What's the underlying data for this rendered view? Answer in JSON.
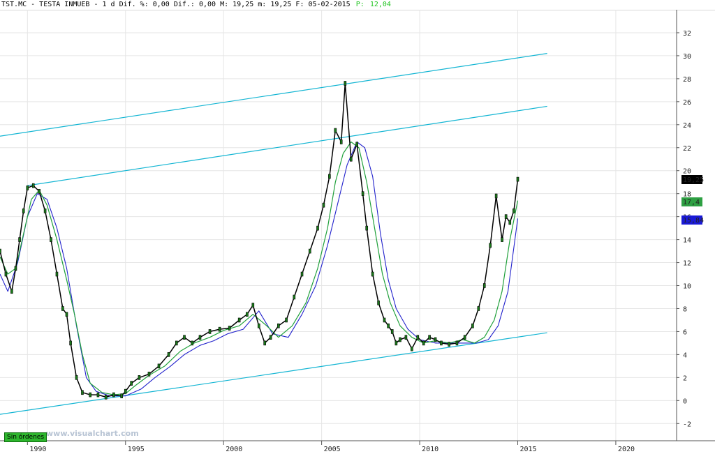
{
  "header": {
    "symbol_info": "TST.MC - TESTA INMUEB - 1 d Dif. %: 0,00 Dif.: 0,00 M: 19,25 m: 19,25 F: 05-02-2015",
    "p_label": "P:",
    "p_value": "12,04"
  },
  "badges": {
    "last_price": "19,25",
    "green_ma": "17,4",
    "blue_ma": "15,84"
  },
  "footer": {
    "status_button": "Sin órdenes",
    "watermark": "www.visualchart.com"
  },
  "colors": {
    "price": "#000000",
    "price_body": "#1a7a1a",
    "fast_ma": "#1fa03a",
    "slow_ma": "#2222cc",
    "channel": "#13b5d3",
    "grid": "#e6e6e6",
    "badge_last": "#000000",
    "badge_green": "#2ea043",
    "badge_blue": "#1a1ad6"
  },
  "chart_data": {
    "type": "line",
    "x_ticks": [
      "1990",
      "1995",
      "2000",
      "2005",
      "2010",
      "2015",
      "2020"
    ],
    "y_ticks": [
      "-2",
      "0",
      "2",
      "4",
      "6",
      "8",
      "10",
      "12",
      "14",
      "16",
      "18",
      "20",
      "22",
      "24",
      "26",
      "28",
      "30",
      "32"
    ],
    "ylim": [
      -3.5,
      34
    ],
    "xlim": [
      1988.6,
      2023.1
    ],
    "grid": true,
    "series": [
      {
        "key": "price",
        "x": [
          1988.6,
          1988.9,
          1989.2,
          1989.4,
          1989.6,
          1989.8,
          1990.0,
          1990.3,
          1990.6,
          1990.9,
          1991.2,
          1991.5,
          1991.8,
          1992.0,
          1992.2,
          1992.5,
          1992.8,
          1993.2,
          1993.6,
          1994.0,
          1994.4,
          1994.8,
          1995.0,
          1995.3,
          1995.7,
          1996.2,
          1996.7,
          1997.2,
          1997.6,
          1998.0,
          1998.4,
          1998.8,
          1999.3,
          1999.8,
          2000.3,
          2000.8,
          2001.2,
          2001.5,
          2001.8,
          2002.1,
          2002.4,
          2002.8,
          2003.2,
          2003.6,
          2004.0,
          2004.4,
          2004.8,
          2005.1,
          2005.4,
          2005.7,
          2006.0,
          2006.2,
          2006.5,
          2006.8,
          2007.1,
          2007.3,
          2007.6,
          2007.9,
          2008.2,
          2008.4,
          2008.6,
          2008.8,
          2009.0,
          2009.3,
          2009.6,
          2009.9,
          2010.2,
          2010.5,
          2010.8,
          2011.1,
          2011.5,
          2011.9,
          2012.3,
          2012.7,
          2013.0,
          2013.3,
          2013.6,
          2013.9,
          2014.2,
          2014.4,
          2014.6,
          2014.8,
          2015.0
        ],
        "values": [
          13.0,
          11.0,
          9.5,
          11.5,
          14.0,
          16.5,
          18.5,
          18.7,
          18.2,
          16.5,
          14.0,
          11.0,
          8.0,
          7.5,
          5.0,
          2.0,
          0.7,
          0.5,
          0.5,
          0.3,
          0.5,
          0.4,
          0.8,
          1.5,
          2.0,
          2.3,
          3.0,
          4.0,
          5.0,
          5.5,
          5.0,
          5.5,
          6.0,
          6.2,
          6.3,
          7.0,
          7.5,
          8.3,
          6.5,
          5.0,
          5.5,
          6.5,
          7.0,
          9.0,
          11.0,
          13.0,
          15.0,
          17.0,
          19.5,
          23.5,
          22.5,
          27.6,
          21.0,
          22.3,
          18.0,
          15.0,
          11.0,
          8.5,
          7.0,
          6.5,
          6.0,
          5.0,
          5.3,
          5.5,
          4.5,
          5.5,
          5.0,
          5.5,
          5.3,
          5.0,
          4.9,
          5.0,
          5.5,
          6.5,
          8.0,
          10.0,
          13.5,
          17.8,
          14.0,
          16.0,
          15.5,
          16.5,
          19.25
        ]
      },
      {
        "key": "fast_ma",
        "x": [
          1988.6,
          1989.0,
          1989.4,
          1989.8,
          1990.2,
          1990.6,
          1991.0,
          1991.5,
          1992.0,
          1992.4,
          1992.8,
          1993.2,
          1993.8,
          1994.4,
          1995.0,
          1995.5,
          1996.2,
          1997.0,
          1997.8,
          1998.5,
          1999.3,
          2000.0,
          2000.8,
          2001.5,
          2002.2,
          2002.8,
          2003.5,
          2004.2,
          2004.8,
          2005.3,
          2005.7,
          2006.1,
          2006.5,
          2006.9,
          2007.3,
          2007.7,
          2008.1,
          2008.5,
          2009.0,
          2009.6,
          2010.2,
          2010.8,
          2011.5,
          2012.2,
          2012.8,
          2013.3,
          2013.8,
          2014.2,
          2014.6,
          2015.0
        ],
        "values": [
          12.5,
          11.0,
          11.5,
          14.5,
          17.5,
          18.3,
          17.0,
          14.0,
          10.5,
          7.5,
          4.0,
          1.5,
          0.7,
          0.5,
          0.6,
          1.3,
          2.2,
          3.0,
          4.3,
          5.0,
          5.5,
          6.1,
          6.5,
          7.5,
          6.5,
          5.5,
          6.5,
          8.5,
          11.5,
          15.0,
          19.0,
          21.5,
          22.5,
          22.0,
          19.0,
          15.0,
          11.0,
          8.5,
          6.5,
          5.5,
          5.0,
          5.2,
          5.0,
          5.3,
          5.0,
          5.5,
          7.0,
          9.5,
          14.0,
          17.4
        ]
      },
      {
        "key": "slow_ma",
        "x": [
          1988.6,
          1989.0,
          1989.5,
          1990.0,
          1990.5,
          1991.0,
          1991.5,
          1992.0,
          1992.5,
          1993.0,
          1993.5,
          1994.2,
          1995.0,
          1995.8,
          1996.5,
          1997.3,
          1998.0,
          1998.8,
          1999.5,
          2000.2,
          2001.0,
          2001.8,
          2002.5,
          2003.3,
          2004.0,
          2004.7,
          2005.3,
          2005.8,
          2006.3,
          2006.8,
          2007.2,
          2007.6,
          2008.0,
          2008.4,
          2008.8,
          2009.4,
          2010.0,
          2010.8,
          2011.5,
          2012.2,
          2012.9,
          2013.5,
          2014.0,
          2014.5,
          2015.0
        ],
        "values": [
          11.0,
          9.5,
          12.0,
          16.0,
          18.0,
          17.5,
          15.0,
          11.5,
          6.5,
          2.0,
          0.8,
          0.4,
          0.4,
          1.0,
          2.0,
          3.0,
          4.0,
          4.8,
          5.2,
          5.8,
          6.2,
          7.8,
          5.8,
          5.5,
          7.5,
          10.0,
          13.5,
          17.0,
          20.5,
          22.5,
          22.0,
          19.5,
          14.5,
          10.5,
          8.0,
          6.2,
          5.3,
          5.0,
          5.0,
          5.0,
          5.0,
          5.3,
          6.5,
          9.5,
          15.84
        ]
      }
    ],
    "channel_lines": [
      {
        "x": [
          1988.6,
          2016.5
        ],
        "values": [
          23.0,
          30.2
        ]
      },
      {
        "x": [
          1990.0,
          2016.5
        ],
        "values": [
          18.7,
          25.6
        ]
      },
      {
        "x": [
          1988.6,
          2016.5
        ],
        "values": [
          -1.2,
          5.9
        ]
      }
    ]
  }
}
